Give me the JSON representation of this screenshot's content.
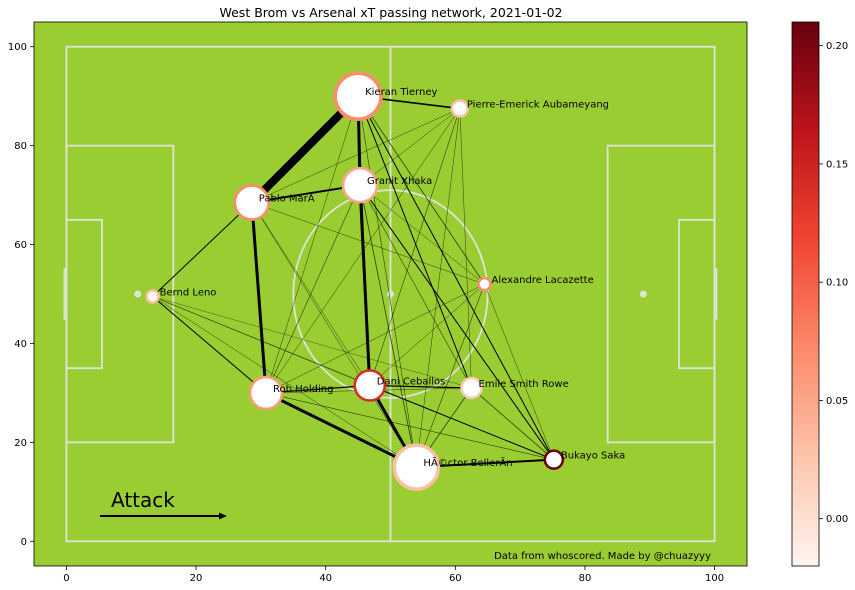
{
  "chart_data": {
    "type": "scatter",
    "title": "West Brom vs Arsenal xT passing network, 2021-01-02",
    "xlabel": "",
    "ylabel": "",
    "xlim": [
      -5,
      105
    ],
    "ylim": [
      -5,
      105
    ],
    "xticks": [
      "0",
      "20",
      "40",
      "60",
      "80",
      "100"
    ],
    "yticks": [
      "0",
      "20",
      "40",
      "60",
      "80",
      "100"
    ],
    "grid": false,
    "players": [
      {
        "name": "Kieran Tierney",
        "x": 45,
        "y": 90,
        "size": 23,
        "xt": 0.07
      },
      {
        "name": "Pierre-Emerick Aubameyang",
        "x": 60.7,
        "y": 87.5,
        "size": 8,
        "xt": 0.03
      },
      {
        "name": "Granit Xhaka",
        "x": 45.3,
        "y": 72,
        "size": 17,
        "xt": 0.05
      },
      {
        "name": "Pablo MarÃ­",
        "x": 28.6,
        "y": 68.5,
        "size": 17,
        "xt": 0.07
      },
      {
        "name": "Alexandre Lacazette",
        "x": 64.5,
        "y": 52,
        "size": 6,
        "xt": 0.07
      },
      {
        "name": "Bernd Leno",
        "x": 13.3,
        "y": 49.5,
        "size": 6,
        "xt": 0.03
      },
      {
        "name": "Rob Holding",
        "x": 30.8,
        "y": 30,
        "size": 16,
        "xt": 0.06
      },
      {
        "name": "Dani Ceballos",
        "x": 46.8,
        "y": 31.5,
        "size": 15,
        "xt": 0.14
      },
      {
        "name": "Emile Smith Rowe",
        "x": 62.5,
        "y": 31,
        "size": 10,
        "xt": 0.02
      },
      {
        "name": "HÃ©ctor BellerÃ­n",
        "x": 54,
        "y": 15,
        "size": 22,
        "xt": 0.03
      },
      {
        "name": "Bukayo Saka",
        "x": 75.2,
        "y": 16.5,
        "size": 9,
        "xt": 0.21
      }
    ],
    "links": [
      {
        "from": 0,
        "to": 3,
        "w": 8
      },
      {
        "from": 0,
        "to": 2,
        "w": 3
      },
      {
        "from": 0,
        "to": 1,
        "w": 1.6
      },
      {
        "from": 3,
        "to": 2,
        "w": 2
      },
      {
        "from": 3,
        "to": 6,
        "w": 3
      },
      {
        "from": 6,
        "to": 9,
        "w": 3
      },
      {
        "from": 2,
        "to": 7,
        "w": 3
      },
      {
        "from": 7,
        "to": 9,
        "w": 3
      },
      {
        "from": 9,
        "to": 10,
        "w": 2
      },
      {
        "from": 3,
        "to": 5,
        "w": 1
      },
      {
        "from": 6,
        "to": 7,
        "w": 1.2
      },
      {
        "from": 7,
        "to": 8,
        "w": 1.2
      },
      {
        "from": 0,
        "to": 8,
        "w": 1
      },
      {
        "from": 0,
        "to": 10,
        "w": 1
      },
      {
        "from": 2,
        "to": 10,
        "w": 1
      },
      {
        "from": 0,
        "to": 4,
        "w": 0.8
      },
      {
        "from": 1,
        "to": 7,
        "w": 0.6
      },
      {
        "from": 1,
        "to": 6,
        "w": 0.5
      },
      {
        "from": 0,
        "to": 6,
        "w": 0.5
      },
      {
        "from": 0,
        "to": 7,
        "w": 0.6
      },
      {
        "from": 0,
        "to": 9,
        "w": 0.6
      },
      {
        "from": 2,
        "to": 8,
        "w": 0.6
      },
      {
        "from": 2,
        "to": 9,
        "w": 0.8
      },
      {
        "from": 2,
        "to": 6,
        "w": 0.6
      },
      {
        "from": 2,
        "to": 4,
        "w": 0.5
      },
      {
        "from": 1,
        "to": 9,
        "w": 0.5
      },
      {
        "from": 1,
        "to": 8,
        "w": 0.5
      },
      {
        "from": 1,
        "to": 2,
        "w": 0.5
      },
      {
        "from": 1,
        "to": 3,
        "w": 0.5
      },
      {
        "from": 4,
        "to": 9,
        "w": 0.6
      },
      {
        "from": 4,
        "to": 7,
        "w": 0.5
      },
      {
        "from": 4,
        "to": 6,
        "w": 0.5
      },
      {
        "from": 4,
        "to": 3,
        "w": 0.5
      },
      {
        "from": 5,
        "to": 6,
        "w": 1
      },
      {
        "from": 5,
        "to": 7,
        "w": 0.5
      },
      {
        "from": 5,
        "to": 9,
        "w": 0.5
      },
      {
        "from": 5,
        "to": 8,
        "w": 0.4
      },
      {
        "from": 5,
        "to": 10,
        "w": 0.4
      },
      {
        "from": 6,
        "to": 10,
        "w": 0.6
      },
      {
        "from": 6,
        "to": 8,
        "w": 0.5
      },
      {
        "from": 7,
        "to": 10,
        "w": 1
      },
      {
        "from": 8,
        "to": 10,
        "w": 0.8
      },
      {
        "from": 8,
        "to": 9,
        "w": 0.8
      },
      {
        "from": 10,
        "to": 4,
        "w": 0.5
      },
      {
        "from": 3,
        "to": 7,
        "w": 0.5
      },
      {
        "from": 3,
        "to": 9,
        "w": 0.5
      }
    ],
    "colorbar": {
      "ticks": [
        "0.00",
        "0.05",
        "0.10",
        "0.15",
        "0.20"
      ],
      "tick_values": [
        0,
        0.05,
        0.1,
        0.15,
        0.2
      ],
      "min": -0.02,
      "max": 0.21
    },
    "annotations": {
      "attack": "Attack",
      "credit": "Data from whoscored. Made by @chuazyyy"
    }
  },
  "colors": {
    "pitch": "#9acd32",
    "pitch_lines": "#dfe3d8"
  }
}
